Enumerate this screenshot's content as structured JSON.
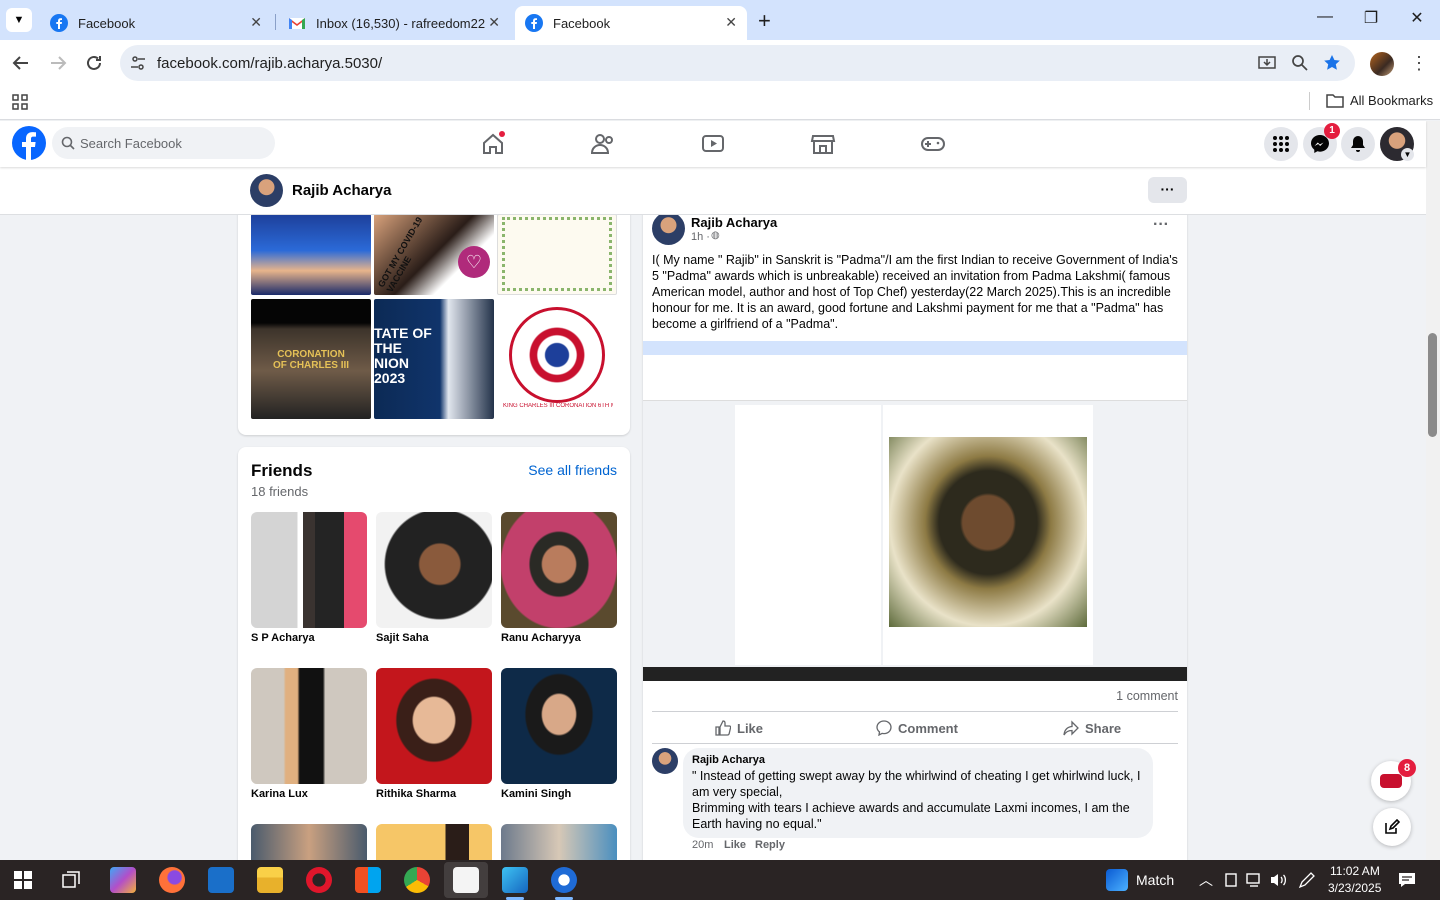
{
  "browser": {
    "tabs": [
      {
        "title": "Facebook"
      },
      {
        "title": "Inbox (16,530) - rafreedom22@"
      },
      {
        "title": "Facebook"
      }
    ],
    "url": "facebook.com/rajib.acharya.5030/",
    "bookmarks_label": "All Bookmarks"
  },
  "facebook": {
    "search_placeholder": "Search Facebook",
    "messenger_badge": "1",
    "profile_name": "Rajib Acharya",
    "more_label": "···"
  },
  "friends": {
    "title": "Friends",
    "see_all": "See all friends",
    "count": "18 friends",
    "items": [
      {
        "name": "S P Acharya"
      },
      {
        "name": "Sajit Saha"
      },
      {
        "name": "Ranu Acharyya"
      },
      {
        "name": "Karina Lux"
      },
      {
        "name": "Rithika Sharma"
      },
      {
        "name": "Kamini Singh"
      }
    ]
  },
  "photos": {
    "captions": [
      "GOT MY COVID-19 VACCINE",
      "CORONATION OF CHARLES III",
      "TATE OF THE NION 2023",
      "KING CHARLES III CORONATION 6TH MAY 2023"
    ]
  },
  "post": {
    "author": "Rajib Acharya",
    "time": "1h ·",
    "text": "I( My name \" Rajib\" in Sanskrit is \"Padma\"/I am the first Indian to receive Government of India's 5 \"Padma\" awards which is unbreakable) received an invitation from Padma Lakshmi( famous American model, author and host of Top Chef) yesterday(22 March 2025).This is an incredible honour for me. It is an award, good fortune and Lakshmi payment  for me that a \"Padma\" has become a  girlfriend of a \"Padma\".",
    "comment_count": "1 comment",
    "actions": {
      "like": "Like",
      "comment": "Comment",
      "share": "Share"
    },
    "comment": {
      "author": "Rajib Acharya",
      "text": "\" Instead of getting swept away by the whirlwind of cheating I get whirlwind luck, I am very special,\nBrimming with tears I achieve awards and accumulate Laxmi incomes, I am the Earth having no equal.\"",
      "time": "20m",
      "like": "Like",
      "reply": "Reply"
    }
  },
  "chat_badge": "8",
  "taskbar": {
    "weather": "Match",
    "time": "11:02 AM",
    "date": "3/23/2025"
  }
}
